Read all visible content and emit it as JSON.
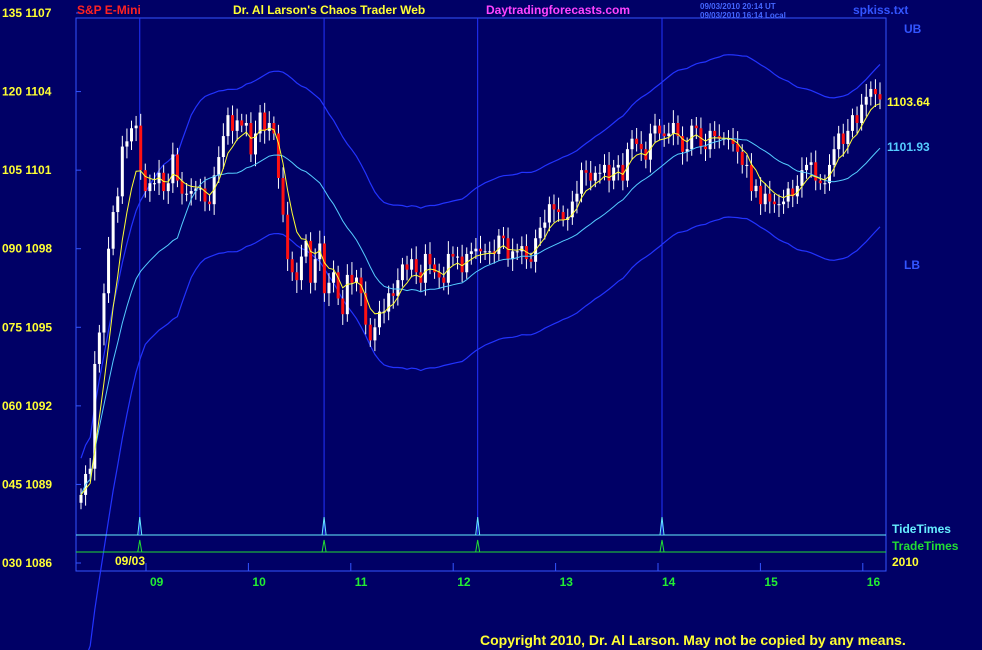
{
  "header": {
    "instrument": "S&P E-Mini",
    "title": "Dr. Al Larson's Chaos Trader Web",
    "site": "Daytradingforecasts.com",
    "timestamp_1": "09/03/2010 20:14 UT",
    "timestamp_2": "09/03/2010 16:14 Local",
    "file": "spkiss.txt"
  },
  "footer": {
    "copyright": "Copyright 2010, Dr. Al Larson. May not be copied by any means."
  },
  "colors": {
    "background": "#000066",
    "frame": "#3355ff",
    "up_candle": "#ffffff",
    "down_candle": "#ff1111",
    "envelope": "#2233ff",
    "slow_ma": "#55ccff",
    "fast_ma": "#ffff33",
    "tide_times": "#66eeff",
    "trade_times": "#22dd33",
    "axis_label": "#ffff33",
    "day_label": "#22ee33",
    "title": "#ffff33",
    "instrument": "#ff2222",
    "site": "#ff44ff"
  },
  "chart_data": {
    "type": "candlestick",
    "y_axis": {
      "range": [
        1086,
        1107
      ],
      "ticks": [
        {
          "value": 1107,
          "label": "135 1107"
        },
        {
          "value": 1104,
          "label": "120 1104"
        },
        {
          "value": 1101,
          "label": "105 1101"
        },
        {
          "value": 1098,
          "label": "090 1098"
        },
        {
          "value": 1095,
          "label": "075 1095"
        },
        {
          "value": 1092,
          "label": "060 1092"
        },
        {
          "value": 1089,
          "label": "045 1089"
        },
        {
          "value": 1086,
          "label": "030 1086"
        }
      ]
    },
    "x_axis": {
      "day_labels": [
        {
          "day": 9,
          "label": "09"
        },
        {
          "day": 10,
          "label": "10"
        },
        {
          "day": 11,
          "label": "11"
        },
        {
          "day": 12,
          "label": "12"
        },
        {
          "day": 13,
          "label": "13"
        },
        {
          "day": 14,
          "label": "14"
        },
        {
          "day": 15,
          "label": "15"
        },
        {
          "day": 16,
          "label": "16"
        }
      ],
      "start_label": "09/03",
      "year_label": "2010"
    },
    "right_labels": {
      "upper_band": "UB",
      "lower_band": "LB",
      "fast_value": "1103.64",
      "slow_value": "1101.93",
      "tide_times": "TideTimes",
      "trade_times": "TradeTimes"
    },
    "vertical_marker_days": [
      8.9,
      10.7,
      12.2,
      14.0
    ],
    "closes": [
      1088.6,
      1089.4,
      1089.6,
      1093.6,
      1094.8,
      1096.3,
      1098.0,
      1099.4,
      1100.0,
      1101.9,
      1102.1,
      1102.6,
      1102.7,
      1101.0,
      1100.2,
      1100.5,
      1100.5,
      1100.9,
      1100.2,
      1100.5,
      1101.6,
      1100.6,
      1100.1,
      1100.1,
      1100.2,
      1100.3,
      1100.3,
      1099.8,
      1099.7,
      1100.8,
      1101.5,
      1102.3,
      1103.1,
      1102.5,
      1102.9,
      1102.7,
      1102.8,
      1101.6,
      1102.4,
      1103.2,
      1102.5,
      1102.8,
      1102.4,
      1100.7,
      1099.3,
      1097.6,
      1097.1,
      1096.8,
      1097.7,
      1098.3,
      1096.7,
      1097.6,
      1098.2,
      1096.3,
      1096.7,
      1097.1,
      1096.1,
      1095.5,
      1097.0,
      1096.7,
      1096.9,
      1096.3,
      1095.1,
      1094.5,
      1095.0,
      1095.6,
      1095.6,
      1096.3,
      1096.2,
      1096.8,
      1097.4,
      1097.2,
      1097.6,
      1097.1,
      1096.7,
      1097.8,
      1097.4,
      1097.1,
      1096.9,
      1096.7,
      1097.8,
      1097.7,
      1097.7,
      1097.1,
      1097.8,
      1097.9,
      1098.0,
      1097.9,
      1097.9,
      1097.9,
      1097.8,
      1098.5,
      1098.4,
      1097.6,
      1097.9,
      1097.9,
      1098.1,
      1097.6,
      1097.5,
      1098.4,
      1098.8,
      1099.0,
      1099.7,
      1099.5,
      1099.4,
      1099.1,
      1099.2,
      1099.8,
      1100.1,
      1101.0,
      1100.9,
      1100.6,
      1100.9,
      1100.9,
      1101.2,
      1100.6,
      1101.1,
      1101.2,
      1100.6,
      1101.8,
      1102.2,
      1102.0,
      1101.8,
      1101.4,
      1102.4,
      1102.7,
      1102.4,
      1102.3,
      1102.4,
      1102.8,
      1102.3,
      1101.7,
      1101.8,
      1102.7,
      1102.6,
      1101.9,
      1101.8,
      1102.5,
      1102.3,
      1102.2,
      1102.2,
      1102.2,
      1102.0,
      1101.7,
      1101.2,
      1101.2,
      1100.2,
      1100.4,
      1099.7,
      1100.1,
      1099.8,
      1099.7,
      1099.7,
      1099.8,
      1100.3,
      1100.0,
      1100.4,
      1101.0,
      1101.2,
      1101.3,
      1100.6,
      1100.5,
      1100.5,
      1101.2,
      1101.8,
      1102.4,
      1102.0,
      1102.5,
      1103.1,
      1102.8,
      1103.5,
      1103.8,
      1104.1,
      1103.9,
      1103.7
    ]
  }
}
